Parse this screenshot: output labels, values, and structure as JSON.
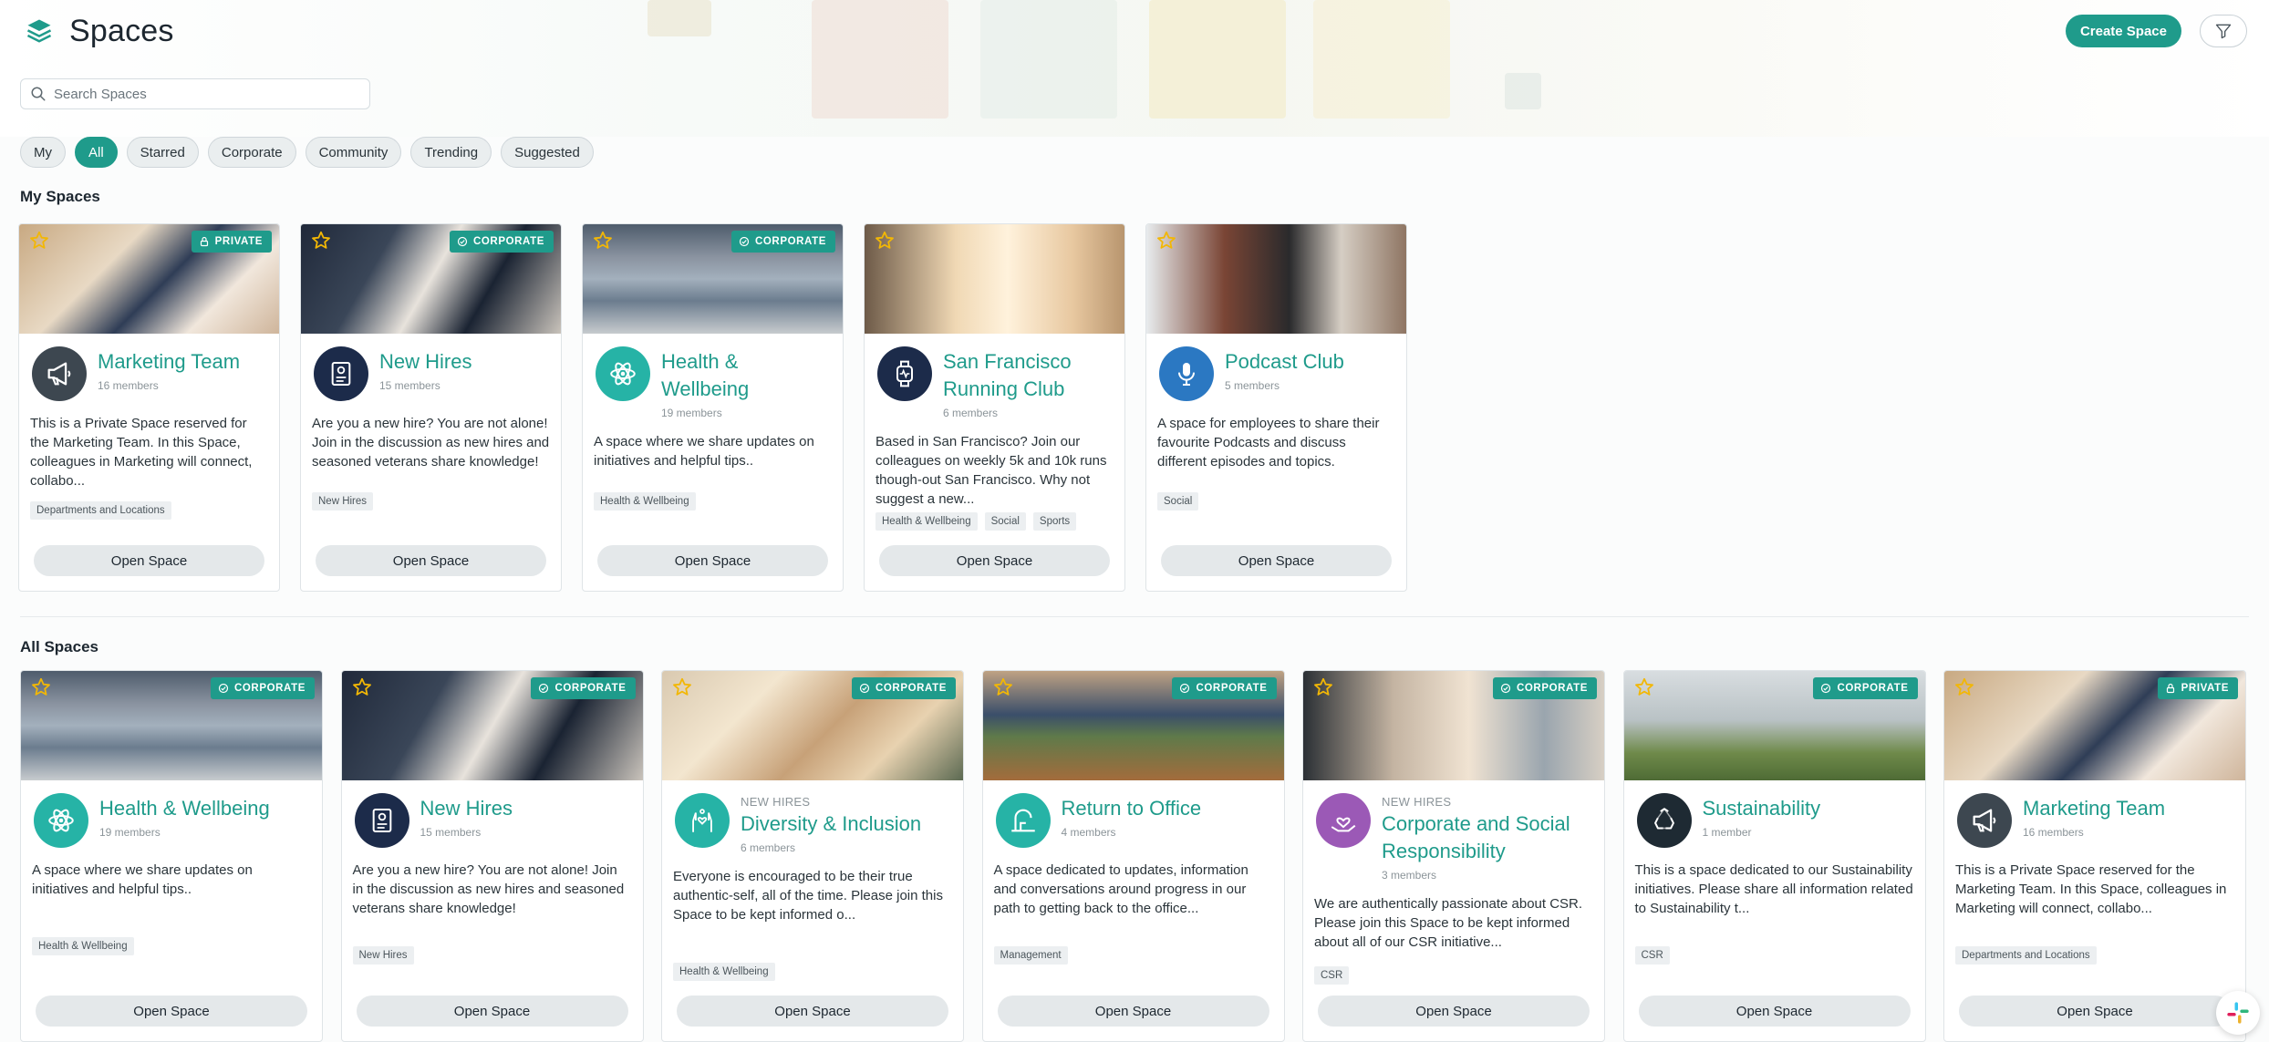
{
  "header": {
    "title": "Spaces",
    "create_label": "Create Space"
  },
  "search": {
    "placeholder": "Search Spaces"
  },
  "filters": [
    "My",
    "All",
    "Starred",
    "Corporate",
    "Community",
    "Trending",
    "Suggested"
  ],
  "active_filter": "All",
  "sections": {
    "my_spaces": "My Spaces",
    "all_spaces": "All Spaces"
  },
  "open_label": "Open Space",
  "colors": {
    "accent": "#1f9b8b",
    "star": "#f2b705",
    "navy": "#1c2b4a",
    "purple": "#9b59b6"
  },
  "my_spaces": [
    {
      "name": "Marketing Team",
      "members": "16 members",
      "badge": "PRIVATE",
      "badge_icon": "lock-icon",
      "avatar_icon": "megaphone-icon",
      "avatar_color": "#3d4750",
      "description": "This is a Private Space reserved for the Marketing Team. In this Space, colleagues in Marketing will connect, collabo...",
      "tags": [
        "Departments and Locations"
      ]
    },
    {
      "name": "New Hires",
      "members": "15 members",
      "badge": "CORPORATE",
      "badge_icon": "check-circle-icon",
      "avatar_icon": "id-card-icon",
      "avatar_color": "#1c2b4a",
      "description": "Are you a new hire? You are not alone! Join in the discussion as new hires and seasoned veterans share knowledge!",
      "tags": [
        "New Hires"
      ]
    },
    {
      "name": "Health & Wellbeing",
      "members": "19 members",
      "badge": "CORPORATE",
      "badge_icon": "check-circle-icon",
      "avatar_icon": "atom-icon",
      "avatar_color": "#26b3a6",
      "description": "A space where we share updates on initiatives and helpful tips..",
      "tags": [
        "Health & Wellbeing"
      ]
    },
    {
      "name": "San Francisco Running Club",
      "members": "6 members",
      "badge": "",
      "badge_icon": "",
      "avatar_icon": "smartwatch-icon",
      "avatar_color": "#1c2b4a",
      "description": "Based in San Francisco? Join our colleagues on weekly 5k and 10k runs though-out San Francisco. Why not suggest a new...",
      "tags": [
        "Health & Wellbeing",
        "Social",
        "Sports"
      ]
    },
    {
      "name": "Podcast Club",
      "members": "5 members",
      "badge": "",
      "badge_icon": "",
      "avatar_icon": "microphone-icon",
      "avatar_color": "#2b78c2",
      "description": "A space for employees to share their favourite Podcasts and discuss different episodes and topics.",
      "tags": [
        "Social"
      ]
    }
  ],
  "all_spaces": [
    {
      "kicker": "",
      "name": "Health & Wellbeing",
      "members": "19 members",
      "badge": "CORPORATE",
      "badge_icon": "check-circle-icon",
      "avatar_icon": "atom-icon",
      "avatar_color": "#26b3a6",
      "description": "A space where we share updates on initiatives and helpful tips..",
      "tags": [
        "Health & Wellbeing"
      ]
    },
    {
      "kicker": "",
      "name": "New Hires",
      "members": "15 members",
      "badge": "CORPORATE",
      "badge_icon": "check-circle-icon",
      "avatar_icon": "id-card-icon",
      "avatar_color": "#1c2b4a",
      "description": "Are you a new hire? You are not alone! Join in the discussion as new hires and seasoned veterans share knowledge!",
      "tags": [
        "New Hires"
      ]
    },
    {
      "kicker": "NEW HIRES",
      "name": "Diversity & Inclusion",
      "members": "6 members",
      "badge": "CORPORATE",
      "badge_icon": "check-circle-icon",
      "avatar_icon": "hands-heart-icon",
      "avatar_color": "#26b3a6",
      "description": "Everyone is encouraged to be their true authentic-self, all of the time. Please join this Space to be kept informed o...",
      "tags": [
        "Health & Wellbeing"
      ]
    },
    {
      "kicker": "",
      "name": "Return to Office",
      "members": "4 members",
      "badge": "CORPORATE",
      "badge_icon": "check-circle-icon",
      "avatar_icon": "office-icon",
      "avatar_color": "#26b3a6",
      "description": "A space dedicated to updates, information and conversations around progress in our path to getting back to the office...",
      "tags": [
        "Management"
      ]
    },
    {
      "kicker": "NEW HIRES",
      "name": "Corporate and Social Responsibility",
      "members": "3 members",
      "badge": "CORPORATE",
      "badge_icon": "check-circle-icon",
      "avatar_icon": "heart-hand-icon",
      "avatar_color": "#9b59b6",
      "description": "We are authentically passionate about CSR. Please join this Space to be kept informed about all of our CSR initiative...",
      "tags": [
        "CSR"
      ]
    },
    {
      "kicker": "",
      "name": "Sustainability",
      "members": "1 member",
      "badge": "CORPORATE",
      "badge_icon": "check-circle-icon",
      "avatar_icon": "recycle-icon",
      "avatar_color": "#1e2a33",
      "description": "This is a space dedicated to our Sustainability initiatives. Please share all information related to Sustainability t...",
      "tags": [
        "CSR"
      ]
    },
    {
      "kicker": "",
      "name": "Marketing Team",
      "members": "16 members",
      "badge": "PRIVATE",
      "badge_icon": "lock-icon",
      "avatar_icon": "megaphone-icon",
      "avatar_color": "#3d4750",
      "description": "This is a Private Space reserved for the Marketing Team. In this Space, colleagues in Marketing will connect, collabo...",
      "tags": [
        "Departments and Locations"
      ]
    }
  ]
}
